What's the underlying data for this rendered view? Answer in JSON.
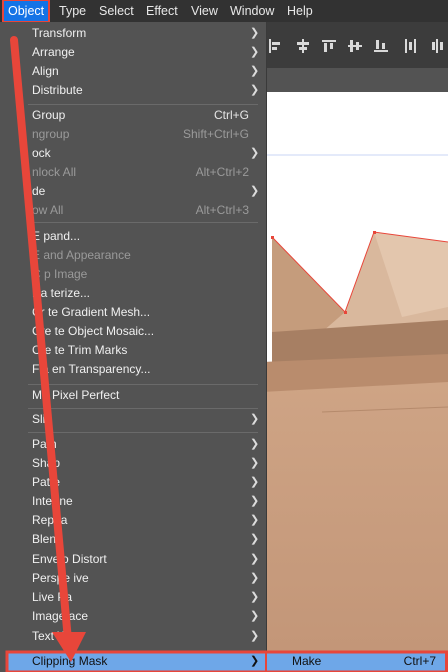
{
  "menubar": {
    "items": [
      "Object",
      "Type",
      "Select",
      "Effect",
      "View",
      "Window",
      "Help"
    ]
  },
  "object_menu": {
    "items": [
      {
        "label": "Transform",
        "shortcut": "",
        "submenu": true,
        "disabled": false
      },
      {
        "label": "Arrange",
        "shortcut": "",
        "submenu": true,
        "disabled": false
      },
      {
        "label": "Align",
        "shortcut": "",
        "submenu": true,
        "disabled": false
      },
      {
        "label": "Distribute",
        "shortcut": "",
        "submenu": true,
        "disabled": false
      },
      {
        "label": "Group",
        "shortcut": "Ctrl+G",
        "submenu": false,
        "disabled": false
      },
      {
        "label": "ngroup",
        "shortcut": "Shift+Ctrl+G",
        "submenu": false,
        "disabled": true
      },
      {
        "label": "ock",
        "shortcut": "",
        "submenu": true,
        "disabled": false
      },
      {
        "label": "nlock All",
        "shortcut": "Alt+Ctrl+2",
        "submenu": false,
        "disabled": true
      },
      {
        "label": "de",
        "shortcut": "",
        "submenu": true,
        "disabled": false
      },
      {
        "label": "ow All",
        "shortcut": "Alt+Ctrl+3",
        "submenu": false,
        "disabled": true
      },
      {
        "label": "E pand...",
        "shortcut": "",
        "submenu": false,
        "disabled": false
      },
      {
        "label": "E and Appearance",
        "shortcut": "",
        "submenu": false,
        "disabled": true
      },
      {
        "label": "C p Image",
        "shortcut": "",
        "submenu": false,
        "disabled": true
      },
      {
        "label": "Ra terize...",
        "shortcut": "",
        "submenu": false,
        "disabled": false
      },
      {
        "label": "Cr te Gradient Mesh...",
        "shortcut": "",
        "submenu": false,
        "disabled": false
      },
      {
        "label": "Cre te Object Mosaic...",
        "shortcut": "",
        "submenu": false,
        "disabled": false
      },
      {
        "label": "Cre te Trim Marks",
        "shortcut": "",
        "submenu": false,
        "disabled": false
      },
      {
        "label": "Fla en Transparency...",
        "shortcut": "",
        "submenu": false,
        "disabled": false
      },
      {
        "label": "Ma Pixel Perfect",
        "shortcut": "",
        "submenu": false,
        "disabled": false
      },
      {
        "label": "Slic",
        "shortcut": "",
        "submenu": true,
        "disabled": false
      },
      {
        "label": "Path",
        "shortcut": "",
        "submenu": true,
        "disabled": false
      },
      {
        "label": "Shap",
        "shortcut": "",
        "submenu": true,
        "disabled": false
      },
      {
        "label": "Patte",
        "shortcut": "",
        "submenu": true,
        "disabled": false
      },
      {
        "label": "Inter ne",
        "shortcut": "",
        "submenu": true,
        "disabled": false
      },
      {
        "label": "Repea",
        "shortcut": "",
        "submenu": true,
        "disabled": false
      },
      {
        "label": "Blend",
        "shortcut": "",
        "submenu": true,
        "disabled": false
      },
      {
        "label": "Envelo Distort",
        "shortcut": "",
        "submenu": true,
        "disabled": false
      },
      {
        "label": "Perspe ive",
        "shortcut": "",
        "submenu": true,
        "disabled": false
      },
      {
        "label": "Live Pa",
        "shortcut": "",
        "submenu": true,
        "disabled": false
      },
      {
        "label": "Image ace",
        "shortcut": "",
        "submenu": true,
        "disabled": false
      },
      {
        "label": "Text W",
        "shortcut": "",
        "submenu": true,
        "disabled": false
      }
    ],
    "clipping_mask": {
      "label": "Clipping Mask",
      "submenu": true
    }
  },
  "clipping_submenu": {
    "make": {
      "label": "Make",
      "shortcut": "Ctrl+7"
    }
  },
  "colors": {
    "highlight": "#1473e6",
    "annotation_red": "#e8463a",
    "selected_item": "#6ea7e8"
  }
}
